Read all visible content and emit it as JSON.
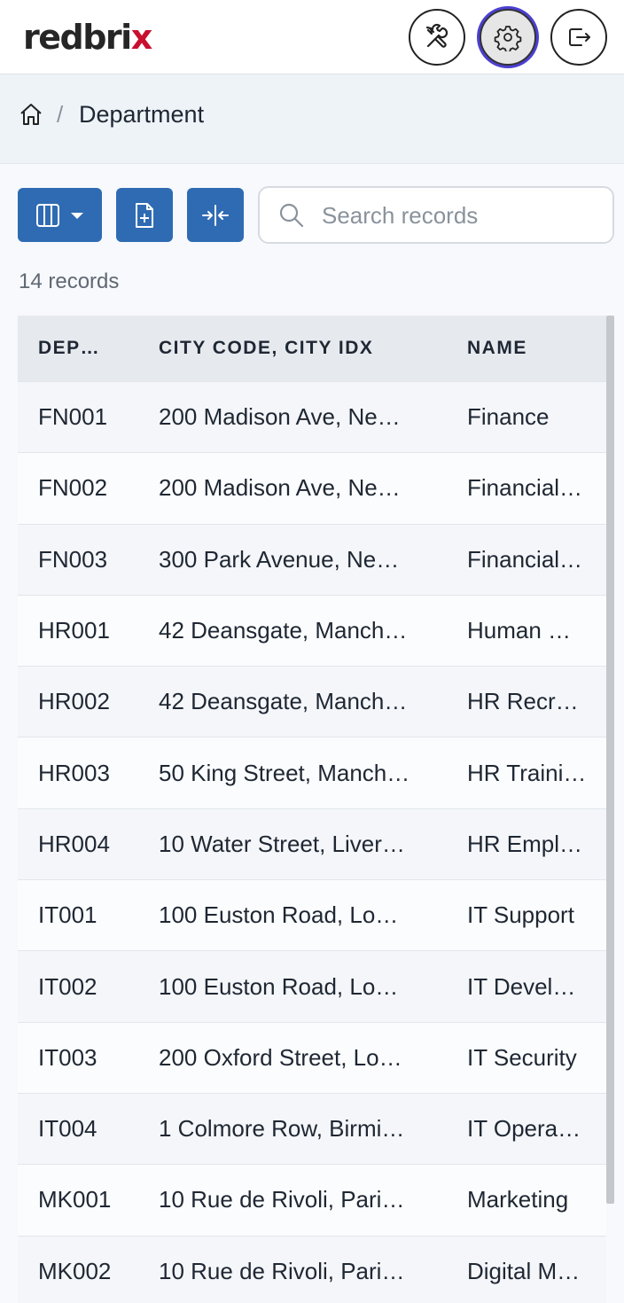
{
  "header": {
    "logo_main": "redbri",
    "logo_mark": "x",
    "tools_icon": "tools-icon",
    "settings_icon": "gear-icon",
    "logout_icon": "logout-icon"
  },
  "breadcrumb": {
    "home_icon": "home-icon",
    "separator": "/",
    "current": "Department"
  },
  "toolbar": {
    "columns_icon": "columns-icon",
    "add_icon": "add-file-icon",
    "resize_icon": "resize-columns-icon",
    "search_placeholder": "Search records"
  },
  "records_count": "14 records",
  "table": {
    "headers": [
      "DEP…",
      "CITY CODE, CITY IDX",
      "NAME"
    ],
    "rows": [
      [
        "FN001",
        "200 Madison Ave, Ne…",
        "Finance"
      ],
      [
        "FN002",
        "200 Madison Ave, Ne…",
        "Financial…"
      ],
      [
        "FN003",
        "300 Park Avenue, Ne…",
        "Financial…"
      ],
      [
        "HR001",
        "42 Deansgate, Manch…",
        "Human …"
      ],
      [
        "HR002",
        "42 Deansgate, Manch…",
        "HR Recr…"
      ],
      [
        "HR003",
        "50 King Street, Manch…",
        "HR Traini…"
      ],
      [
        "HR004",
        "10 Water Street, Liver…",
        "HR Empl…"
      ],
      [
        "IT001",
        "100 Euston Road, Lo…",
        "IT Support"
      ],
      [
        "IT002",
        "100 Euston Road, Lo…",
        "IT Devel…"
      ],
      [
        "IT003",
        "200 Oxford Street, Lo…",
        "IT Security"
      ],
      [
        "IT004",
        "1 Colmore Row, Birmi…",
        "IT Opera…"
      ],
      [
        "MK001",
        "10 Rue de Rivoli, Pari…",
        "Marketing"
      ],
      [
        "MK002",
        "10 Rue de Rivoli, Pari…",
        "Digital M…"
      ]
    ]
  },
  "colors": {
    "accent": "#2f6bb3",
    "brand_red": "#c8102e",
    "focus_ring": "#4b3fd1"
  }
}
